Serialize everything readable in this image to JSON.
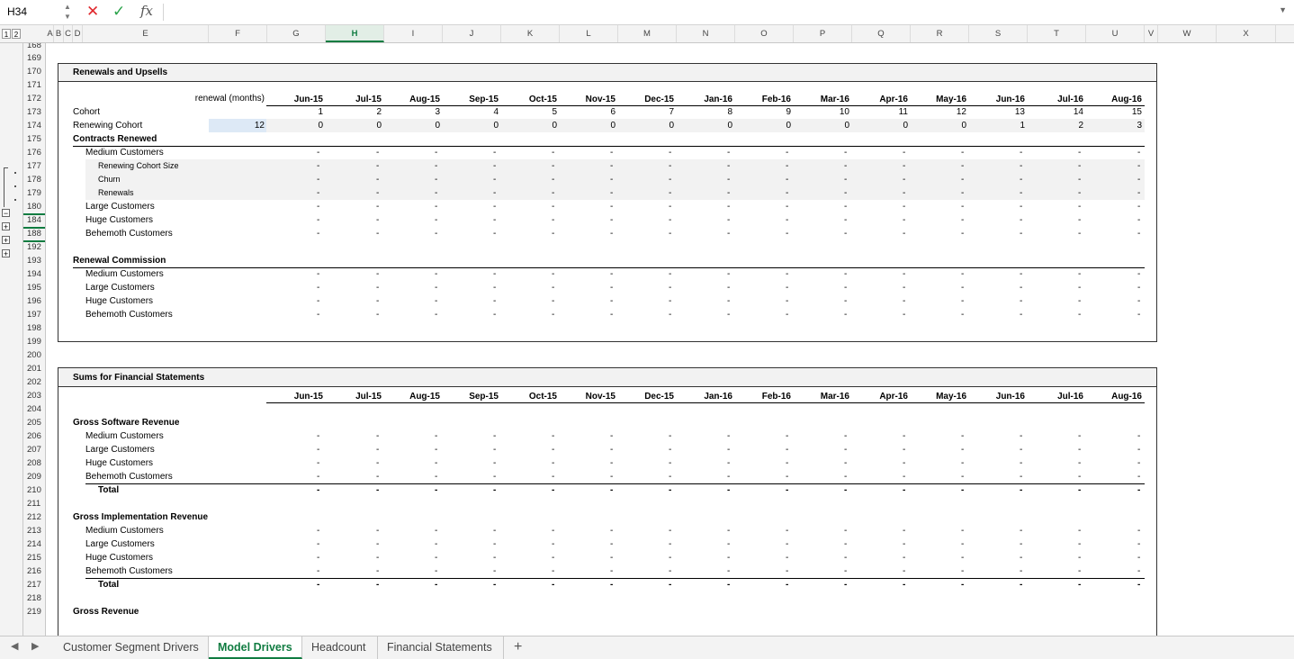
{
  "formula": {
    "cell_ref": "H34",
    "cancel_icon": "close-icon",
    "confirm_icon": "check-icon",
    "fx_label": "fx",
    "content": ""
  },
  "outline_levels": [
    "1",
    "2"
  ],
  "columns": [
    "A",
    "B",
    "C",
    "D",
    "E",
    "F",
    "G",
    "H",
    "I",
    "J",
    "K",
    "L",
    "M",
    "N",
    "O",
    "P",
    "Q",
    "R",
    "S",
    "T",
    "U",
    "V",
    "W",
    "X"
  ],
  "selected_column": "H",
  "rows": [
    "168",
    "169",
    "170",
    "171",
    "172",
    "173",
    "174",
    "175",
    "176",
    "177",
    "178",
    "179",
    "180",
    "184",
    "188",
    "192",
    "193",
    "194",
    "195",
    "196",
    "197",
    "198",
    "199",
    "200",
    "201",
    "202",
    "203",
    "204",
    "205",
    "206",
    "207",
    "208",
    "209",
    "210",
    "211",
    "212",
    "213",
    "214",
    "215",
    "216",
    "217",
    "218",
    "219"
  ],
  "outline_buttons": [
    "−",
    "+",
    "+",
    "+"
  ],
  "months": [
    "Jun-15",
    "Jul-15",
    "Aug-15",
    "Sep-15",
    "Oct-15",
    "Nov-15",
    "Dec-15",
    "Jan-16",
    "Feb-16",
    "Mar-16",
    "Apr-16",
    "May-16",
    "Jun-16",
    "Jul-16",
    "Aug-16"
  ],
  "dash": "-",
  "renewals": {
    "title": "Renewals and Upsells",
    "renewal_label": "renewal (months)",
    "cohort_label": "Cohort",
    "cohort_values": [
      "1",
      "2",
      "3",
      "4",
      "5",
      "6",
      "7",
      "8",
      "9",
      "10",
      "11",
      "12",
      "13",
      "14",
      "15"
    ],
    "renewing_label": "Renewing Cohort",
    "renewing_input": "12",
    "renewing_values": [
      "0",
      "0",
      "0",
      "0",
      "0",
      "0",
      "0",
      "0",
      "0",
      "0",
      "0",
      "0",
      "1",
      "2",
      "3"
    ],
    "contracts_label": "Contracts Renewed",
    "medium": "Medium Customers",
    "cohort_size": "Renewing Cohort Size",
    "churn": "Churn",
    "renewals": "Renewals",
    "large": "Large Customers",
    "huge": "Huge Customers",
    "behemoth": "Behemoth Customers",
    "commission_label": "Renewal Commission"
  },
  "sums": {
    "title": "Sums for Financial Statements",
    "software_label": "Gross Software Revenue",
    "implementation_label": "Gross Implementation Revenue",
    "revenue_label": "Gross Revenue",
    "medium": "Medium Customers",
    "large": "Large Customers",
    "huge": "Huge Customers",
    "behemoth": "Behemoth Customers",
    "total": "Total"
  },
  "tabs": [
    {
      "label": "Customer Segment Drivers",
      "active": false
    },
    {
      "label": "Model Drivers",
      "active": true
    },
    {
      "label": "Headcount",
      "active": false
    },
    {
      "label": "Financial Statements",
      "active": false
    }
  ],
  "add_tab": "+",
  "nav": {
    "prev": "◀",
    "next": "▶"
  }
}
